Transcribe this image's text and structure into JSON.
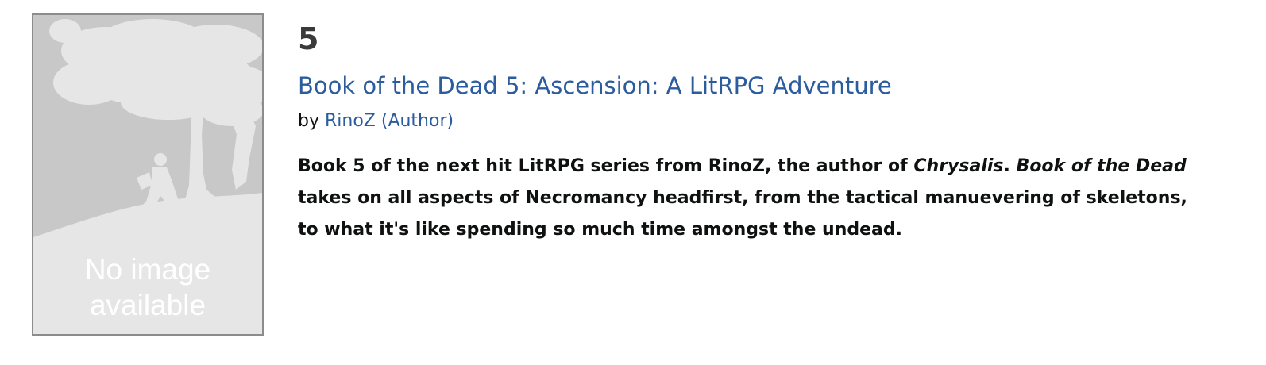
{
  "result": {
    "number": "5",
    "title": "Book of the Dead 5: Ascension: A LitRPG Adventure",
    "byline": {
      "prefix": "by",
      "author": "RinoZ",
      "role": "(Author)"
    },
    "description": {
      "part1": "Book 5 of the next hit LitRPG series from RinoZ, the author of ",
      "italic1": "Chrysalis",
      "part2": ". ",
      "italic2": "Book of the Dead",
      "part3": " takes on all aspects of Necromancy headfirst, from the tactical manuevering of skeletons, to what it's like spending so much time amongst the undead."
    },
    "cover": {
      "placeholder_line1": "No image",
      "placeholder_line2": "available",
      "icon": "tree-reader-icon"
    }
  },
  "colors": {
    "link": "#2b5c9e",
    "text": "#0f1111",
    "cover_background": "#c8c8c8",
    "cover_border": "#8c8c8c"
  }
}
